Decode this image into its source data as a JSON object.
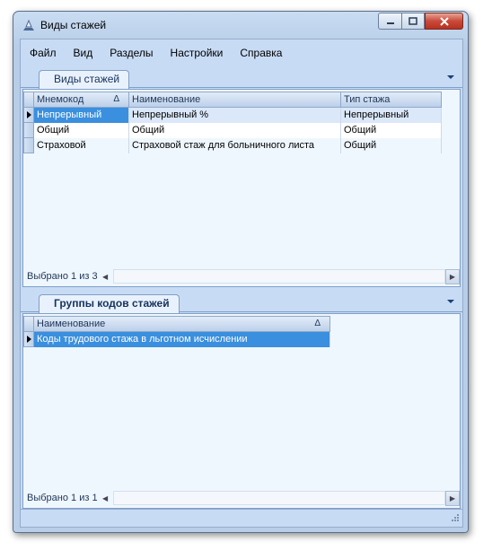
{
  "window": {
    "title": "Виды стажей",
    "minimize_icon": "minimize-icon",
    "maximize_icon": "maximize-icon",
    "close_icon": "close-icon"
  },
  "menu": [
    "Файл",
    "Вид",
    "Разделы",
    "Настройки",
    "Справка"
  ],
  "panel1": {
    "tab": "Виды стажей",
    "columns": [
      "Мнемокод",
      "Наименование",
      "Тип стажа"
    ],
    "sort_indicator": "Δ",
    "rows": [
      [
        "Непрерывный",
        "Непрерывный %",
        "Непрерывный"
      ],
      [
        "Общий",
        "Общий",
        "Общий"
      ],
      [
        "Страховой",
        "Страховой стаж для больничного листа",
        "Общий"
      ]
    ],
    "status": "Выбрано 1 из 3"
  },
  "panel2": {
    "tab": "Группы кодов стажей",
    "columns": [
      "Наименование"
    ],
    "sort_indicator": "Δ",
    "rows": [
      [
        "Коды трудового стажа в льготном исчислении"
      ]
    ],
    "status": "Выбрано 1 из 1"
  },
  "colors": {
    "accent": "#3a8fde",
    "grid_bg": "#eff7fe",
    "chrome": "#c7dbf4"
  }
}
